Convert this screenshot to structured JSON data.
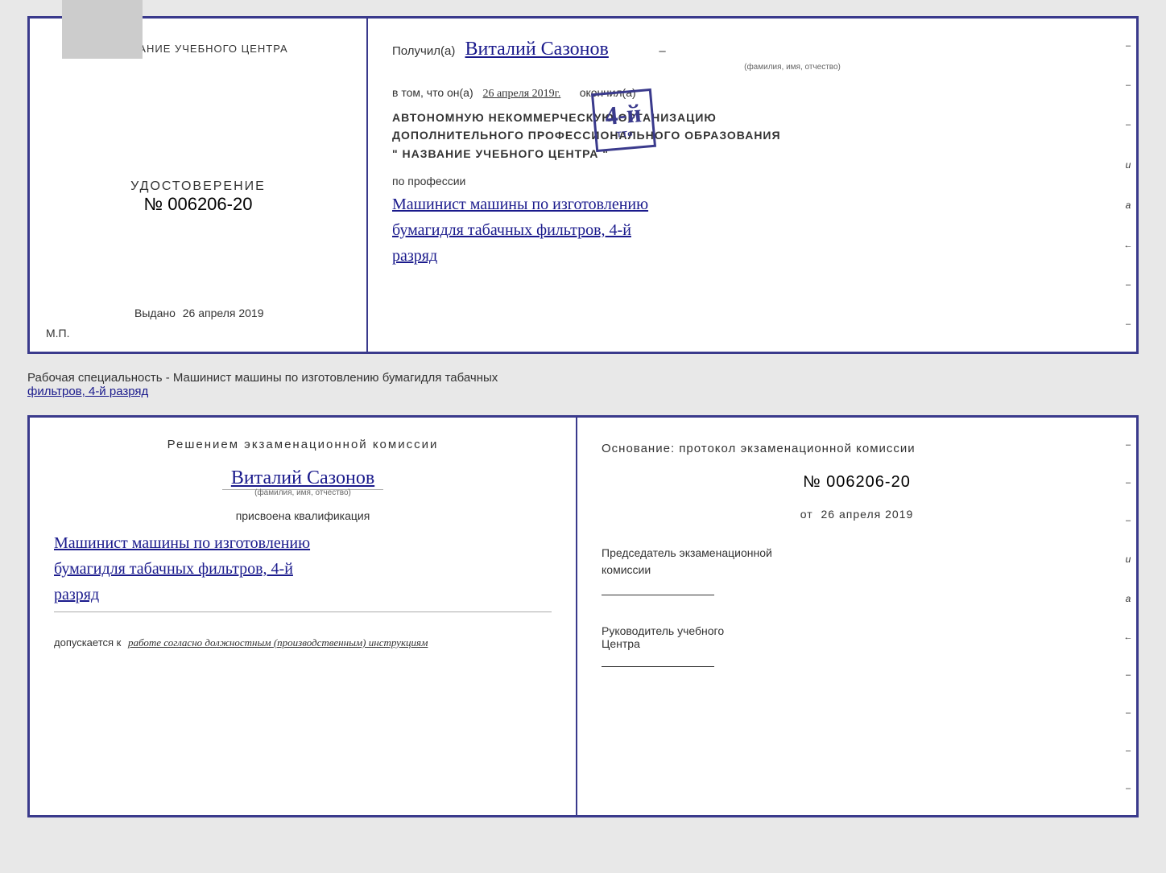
{
  "topDoc": {
    "left": {
      "title": "НАЗВАНИЕ УЧЕБНОГО ЦЕНТРА",
      "udostoverenie_label": "УДОСТОВЕРЕНИЕ",
      "number": "№ 006206-20",
      "vydano_label": "Выдано",
      "vydano_date": "26 апреля 2019",
      "mp_label": "М.П."
    },
    "right": {
      "poluchil_prefix": "Получил(а)",
      "name": "Виталий Сазонов",
      "fio_hint": "(фамилия, имя, отчество)",
      "vtom_prefix": "в том, что он(а)",
      "date_handwritten": "26 апреля 2019г.",
      "okonchil": "окончил(а)",
      "stamp_number": "4-й",
      "org_line1": "АВТОНОМНУЮ НЕКОММЕРЧЕСКУЮ ОРГАНИЗАЦИЮ",
      "org_line2": "ДОПОЛНИТЕЛЬНОГО ПРОФЕССИОНАЛЬНОГО ОБРАЗОВАНИЯ",
      "org_line3": "\" НАЗВАНИЕ УЧЕБНОГО ЦЕНТРА \"",
      "po_professii": "по профессии",
      "profession1": "Машинист машины по изготовлению",
      "profession2": "бумагидля табачных фильтров, 4-й",
      "profession3": "разряд"
    }
  },
  "middleText": {
    "text1": "Рабочая специальность - Машинист машины по изготовлению бумагидля табачных",
    "text2_underline": "фильтров, 4-й разряд"
  },
  "bottomDoc": {
    "left": {
      "resheniem": "Решением экзаменационной комиссии",
      "name": "Виталий Сазонов",
      "fio_hint": "(фамилия, имя, отчество)",
      "prisvoyena": "присвоена квалификация",
      "profession1": "Машинист машины по изготовлению",
      "profession2": "бумагидля табачных фильтров, 4-й",
      "profession3": "разряд",
      "dopuskaetsya_prefix": "допускается к",
      "dopuskaetsya_text": "работе согласно должностным (производственным) инструкциям"
    },
    "right": {
      "osnovanie": "Основание: протокол экзаменационной комиссии",
      "number_label": "№ 006206-20",
      "ot_prefix": "от",
      "ot_date": "26 апреля 2019",
      "predsedatel_line1": "Председатель экзаменационной",
      "predsedatel_line2": "комиссии",
      "rukovoditel_line1": "Руководитель учебного",
      "rukovoditel_line2": "Центра"
    },
    "right_dashes": [
      "-",
      "-",
      "-",
      "и",
      "а",
      "←",
      "-",
      "-",
      "-",
      "-",
      "-"
    ]
  }
}
